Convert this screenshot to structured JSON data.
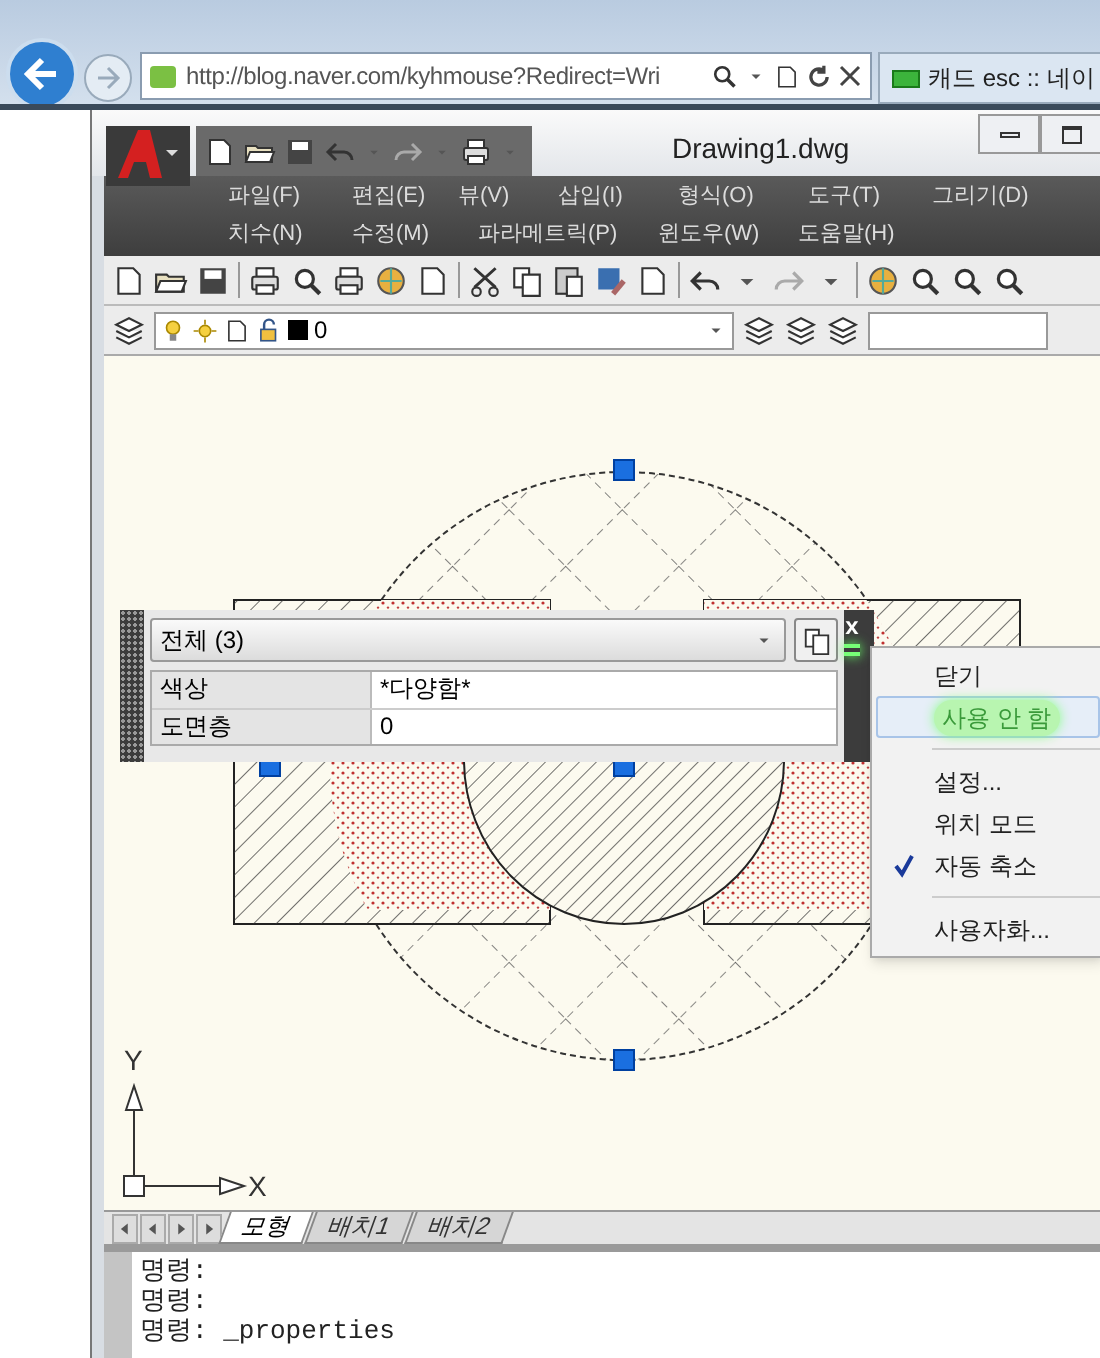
{
  "browser": {
    "address": "http://blog.naver.com/kyhmouse?Redirect=Wri",
    "tab": "캐드 esc :: 네이"
  },
  "window": {
    "title": "Drawing1.dwg"
  },
  "menu_rows": [
    [
      "파일(F)",
      "편집(E)",
      "뷰(V)",
      "삽입(I)",
      "형식(O)",
      "도구(T)",
      "그리기(D)"
    ],
    [
      "치수(N)",
      "수정(M)",
      "파라메트릭(P)",
      "윈도우(W)",
      "도움말(H)"
    ]
  ],
  "layer_toolbar": {
    "layer": "0"
  },
  "ucs": {
    "y_label": "Y",
    "x_label": "X"
  },
  "properties_palette": {
    "selection": "전체 (3)",
    "close": "x",
    "rows": [
      {
        "label": "색상",
        "value": "*다양함*"
      },
      {
        "label": "도면층",
        "value": "0"
      }
    ]
  },
  "context_menu": [
    {
      "kind": "item",
      "label": "닫기",
      "selected": false,
      "checked": false
    },
    {
      "kind": "item",
      "label": "사용 안 함",
      "selected": true,
      "checked": false
    },
    {
      "kind": "separator"
    },
    {
      "kind": "item",
      "label": "설정...",
      "selected": false,
      "checked": false
    },
    {
      "kind": "item",
      "label": "위치 모드",
      "selected": false,
      "checked": false
    },
    {
      "kind": "item",
      "label": "자동 축소",
      "selected": false,
      "checked": true
    },
    {
      "kind": "separator"
    },
    {
      "kind": "item",
      "label": "사용자화...",
      "selected": false,
      "checked": false
    }
  ],
  "layout_tabs": [
    {
      "label": "모형",
      "selected": true
    },
    {
      "label": "배치1",
      "selected": false
    },
    {
      "label": "배치2",
      "selected": false
    }
  ],
  "command_lines": [
    "명령:",
    "명령:",
    "명령: _properties"
  ]
}
